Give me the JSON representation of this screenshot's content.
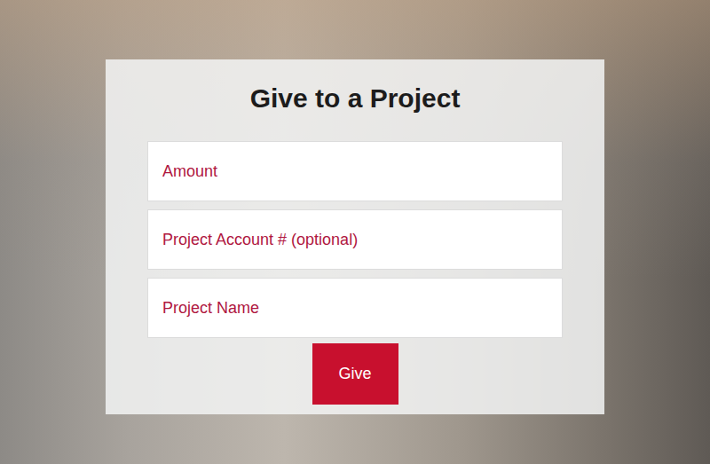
{
  "form": {
    "title": "Give to a Project",
    "fields": [
      {
        "placeholder": "Amount"
      },
      {
        "placeholder": "Project Account # (optional)"
      },
      {
        "placeholder": "Project Name"
      }
    ],
    "button": "Give"
  }
}
